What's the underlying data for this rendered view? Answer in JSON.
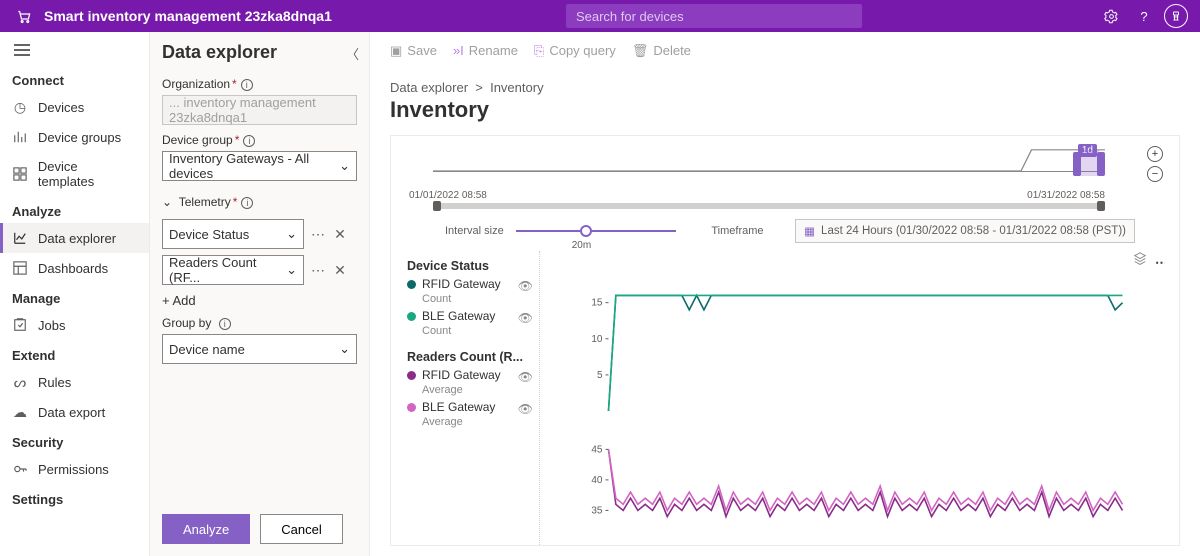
{
  "header": {
    "title": "Smart inventory management 23zka8dnqa1",
    "search_placeholder": "Search for devices"
  },
  "nav": {
    "sections": [
      {
        "label": "Connect",
        "items": [
          "Devices",
          "Device groups",
          "Device templates"
        ]
      },
      {
        "label": "Analyze",
        "items": [
          "Data explorer",
          "Dashboards"
        ],
        "active": "Data explorer"
      },
      {
        "label": "Manage",
        "items": [
          "Jobs"
        ]
      },
      {
        "label": "Extend",
        "items": [
          "Rules",
          "Data export"
        ]
      },
      {
        "label": "Security",
        "items": [
          "Permissions"
        ]
      },
      {
        "label": "Settings",
        "items": []
      }
    ]
  },
  "explorer": {
    "title": "Data explorer",
    "org_label": "Organization",
    "org_value": "... inventory management 23zka8dnqa1",
    "group_label": "Device group",
    "group_value": "Inventory Gateways - All devices",
    "telemetry_label": "Telemetry",
    "telemetry": [
      "Device Status",
      "Readers Count (RF..."
    ],
    "add": "+ Add",
    "groupby_label": "Group by",
    "groupby_value": "Device name",
    "analyze": "Analyze",
    "cancel": "Cancel"
  },
  "toolbar": {
    "save": "Save",
    "rename": "Rename",
    "copy": "Copy query",
    "delete": "Delete"
  },
  "breadcrumb": {
    "root": "Data explorer",
    "leaf": "Inventory"
  },
  "page_title": "Inventory",
  "range": {
    "start": "01/01/2022 08:58",
    "end": "01/31/2022 08:58",
    "badge": "1d",
    "interval_label": "Interval size",
    "interval_value": "20m",
    "timeframe_label": "Timeframe",
    "timeframe_value": "Last 24 Hours (01/30/2022 08:58 - 01/31/2022 08:58 (PST))"
  },
  "legend": {
    "g1": "Device Status",
    "g1_items": [
      {
        "name": "RFID Gateway",
        "sub": "Count",
        "color": "#0b6a6a"
      },
      {
        "name": "BLE Gateway",
        "sub": "Count",
        "color": "#1aa880"
      }
    ],
    "g2": "Readers Count (R...",
    "g2_items": [
      {
        "name": "RFID Gateway",
        "sub": "Average",
        "color": "#8a2d8a"
      },
      {
        "name": "BLE Gateway",
        "sub": "Average",
        "color": "#d264c2"
      }
    ]
  },
  "chart_data": [
    {
      "type": "line",
      "title": "Device Status",
      "ylabel": "",
      "xlabel": "",
      "ylim": [
        0,
        18
      ],
      "yticks": [
        5,
        10,
        15
      ],
      "series": [
        {
          "name": "RFID Gateway (Count)",
          "color": "#0b6a6a",
          "values": [
            0,
            16,
            16,
            16,
            16,
            16,
            16,
            16,
            16,
            16,
            16,
            14,
            16,
            14,
            16,
            16,
            16,
            16,
            16,
            16,
            16,
            16,
            16,
            16,
            16,
            16,
            16,
            16,
            16,
            16,
            16,
            16,
            16,
            16,
            16,
            16,
            16,
            16,
            16,
            16,
            16,
            16,
            16,
            16,
            16,
            16,
            16,
            16,
            16,
            16,
            16,
            16,
            16,
            16,
            16,
            16,
            16,
            16,
            16,
            16,
            16,
            16,
            16,
            16,
            16,
            16,
            16,
            16,
            16,
            14,
            15
          ]
        },
        {
          "name": "BLE Gateway (Count)",
          "color": "#1aa880",
          "values": [
            0,
            16,
            16,
            16,
            16,
            16,
            16,
            16,
            16,
            16,
            16,
            16,
            16,
            16,
            16,
            16,
            16,
            16,
            16,
            16,
            16,
            16,
            16,
            16,
            16,
            16,
            16,
            16,
            16,
            16,
            16,
            16,
            16,
            16,
            16,
            16,
            16,
            16,
            16,
            16,
            16,
            16,
            16,
            16,
            16,
            16,
            16,
            16,
            16,
            16,
            16,
            16,
            16,
            16,
            16,
            16,
            16,
            16,
            16,
            16,
            16,
            16,
            16,
            16,
            16,
            16,
            16,
            16,
            16,
            16,
            16
          ]
        }
      ]
    },
    {
      "type": "line",
      "title": "Readers Count",
      "ylabel": "",
      "xlabel": "",
      "ylim": [
        30,
        48
      ],
      "yticks": [
        35,
        40,
        45
      ],
      "series": [
        {
          "name": "RFID Gateway (Average)",
          "color": "#8a2d8a",
          "values": [
            45,
            36,
            35,
            37,
            35,
            36,
            35,
            37,
            34,
            36,
            35,
            37,
            35,
            36,
            35,
            38,
            34,
            37,
            35,
            36,
            35,
            37,
            34,
            36,
            35,
            37,
            35,
            36,
            35,
            37,
            34,
            36,
            35,
            37,
            35,
            36,
            35,
            38,
            34,
            37,
            35,
            36,
            35,
            37,
            34,
            36,
            35,
            37,
            35,
            36,
            35,
            37,
            34,
            36,
            35,
            37,
            35,
            36,
            35,
            38,
            34,
            37,
            35,
            36,
            35,
            37,
            34,
            36,
            35,
            37,
            35
          ]
        },
        {
          "name": "BLE Gateway (Average)",
          "color": "#d264c2",
          "values": [
            45,
            37,
            36,
            38,
            36,
            37,
            36,
            38,
            35,
            37,
            36,
            38,
            36,
            37,
            36,
            39,
            35,
            38,
            36,
            37,
            36,
            38,
            35,
            37,
            36,
            38,
            36,
            37,
            36,
            38,
            35,
            37,
            36,
            38,
            36,
            37,
            36,
            39,
            35,
            38,
            36,
            37,
            36,
            38,
            35,
            37,
            36,
            38,
            36,
            37,
            36,
            38,
            35,
            37,
            36,
            38,
            36,
            37,
            36,
            39,
            35,
            38,
            36,
            37,
            36,
            38,
            35,
            37,
            36,
            38,
            36
          ]
        }
      ]
    }
  ]
}
